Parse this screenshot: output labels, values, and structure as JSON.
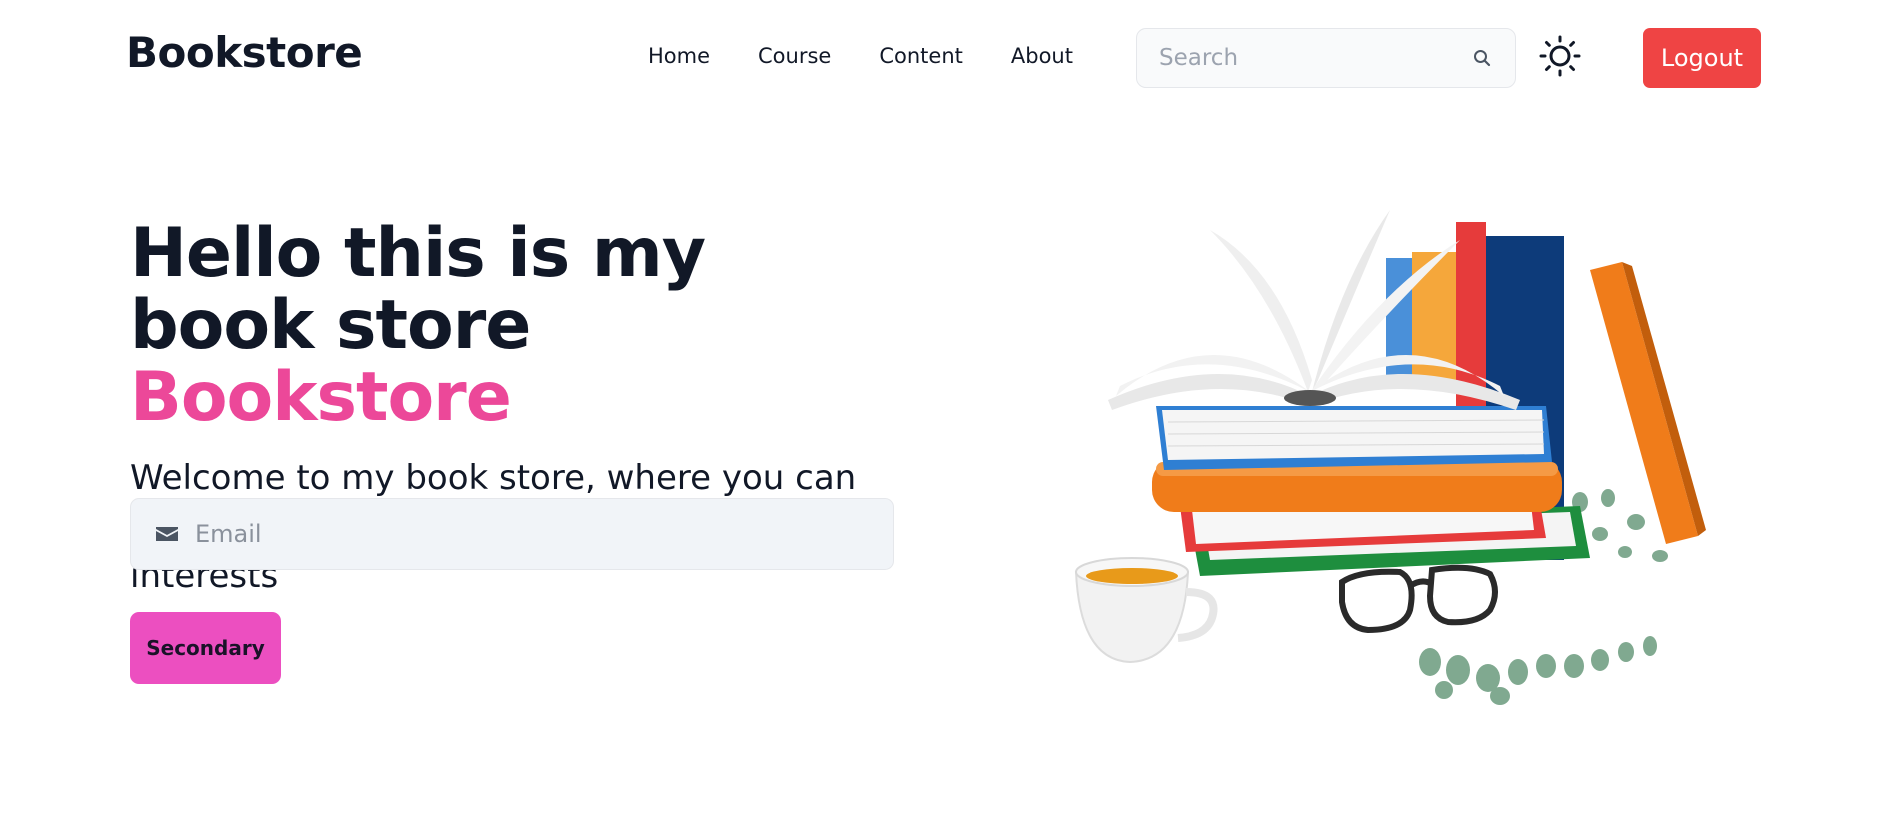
{
  "header": {
    "brand": "Bookstore",
    "nav": [
      {
        "label": "Home"
      },
      {
        "label": "Course"
      },
      {
        "label": "Content"
      },
      {
        "label": "About"
      }
    ],
    "search": {
      "placeholder": "Search",
      "value": "",
      "icon": "search-icon"
    },
    "theme_toggle": {
      "icon": "sun-icon"
    },
    "logout_label": "Logout"
  },
  "hero": {
    "title_main": "Hello this is my book store ",
    "title_accent": "Bookstore",
    "subtitle": "Welcome to my book store, where you can find a wide variety of books to suit your interests",
    "email": {
      "placeholder": "Email",
      "value": "",
      "icon": "mail-icon"
    },
    "button_label": "Secondary",
    "illustration": "books-stack-illustration"
  },
  "colors": {
    "accent": "#ec4899",
    "logout_bg": "#ef4444",
    "secondary_bg": "#ec4fc0",
    "text": "#111827"
  }
}
